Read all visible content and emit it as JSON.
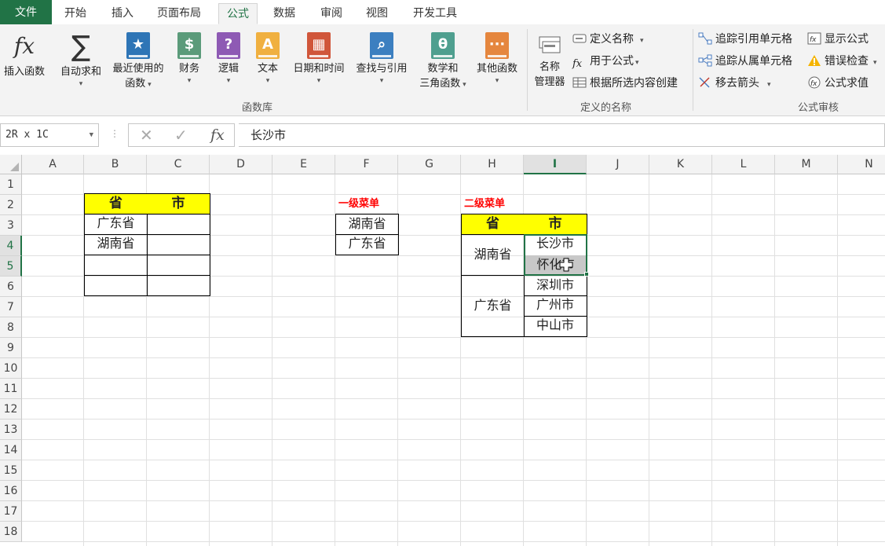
{
  "tabs": [
    "文件",
    "开始",
    "插入",
    "页面布局",
    "公式",
    "数据",
    "审阅",
    "视图",
    "开发工具"
  ],
  "active_tab": "公式",
  "ribbon": {
    "function_library": {
      "insert_function": "插入函数",
      "autosum": "自动求和",
      "recent_line1": "最近使用的",
      "recent_line2": "函数",
      "financial": "财务",
      "logical": "逻辑",
      "text": "文本",
      "datetime": "日期和时间",
      "lookup": "查找与引用",
      "math_line1": "数学和",
      "math_line2": "三角函数",
      "more": "其他函数",
      "group_label": "函数库"
    },
    "defined_names": {
      "name_manager_line1": "名称",
      "name_manager_line2": "管理器",
      "define_name": "定义名称",
      "use_in_formula": "用于公式",
      "create_from_selection": "根据所选内容创建",
      "group_label": "定义的名称"
    },
    "formula_auditing": {
      "trace_precedents": "追踪引用单元格",
      "trace_dependents": "追踪从属单元格",
      "remove_arrows": "移去箭头",
      "show_formulas": "显示公式",
      "error_checking": "错误检查",
      "evaluate_formula": "公式求值",
      "group_label": "公式审核"
    }
  },
  "formula_bar": {
    "name_box": "2R x 1C",
    "cancel_glyph": "✕",
    "enter_glyph": "✓",
    "fx_glyph": "fx",
    "value": "长沙市"
  },
  "columns": [
    "A",
    "B",
    "C",
    "D",
    "E",
    "F",
    "G",
    "H",
    "I",
    "J",
    "K",
    "L",
    "M",
    "N"
  ],
  "selected_column": "I",
  "rows": [
    "1",
    "2",
    "3",
    "4",
    "5",
    "6",
    "7",
    "8",
    "9",
    "10",
    "11",
    "12",
    "13",
    "14",
    "15",
    "16",
    "17",
    "18"
  ],
  "selected_rows": [
    "4",
    "5"
  ],
  "sheet": {
    "table1": {
      "header_province": "省",
      "header_city": "市",
      "r1_province": "广东省",
      "r2_province": "湖南省"
    },
    "level1_label": "一级菜单",
    "level1": {
      "item1": "湖南省",
      "item2": "广东省"
    },
    "level2_label": "二级菜单",
    "level2": {
      "header_province": "省",
      "header_city": "市",
      "hunan": "湖南省",
      "guangdong": "广东省",
      "city1": "长沙市",
      "city2": "怀化市",
      "city3": "深圳市",
      "city4": "广州市",
      "city5": "中山市"
    }
  },
  "colors": {
    "excel_green": "#217346",
    "header_yellow": "#ffff00",
    "label_red": "#ff0000"
  }
}
